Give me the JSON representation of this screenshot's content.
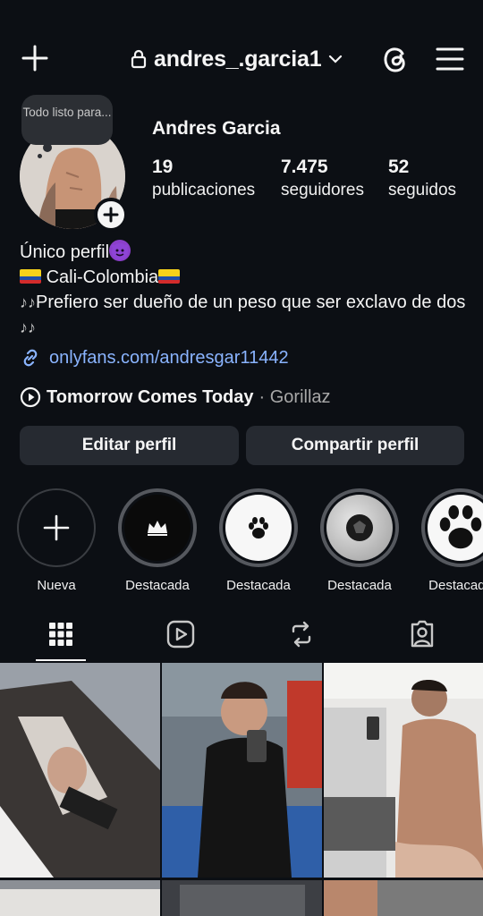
{
  "header": {
    "username": "andres_.garcia1",
    "icons": [
      "plus-icon",
      "lock-icon",
      "chevron-down-icon",
      "threads-icon",
      "menu-icon"
    ]
  },
  "profile": {
    "note": "Todo listo para...",
    "full_name": "Andres Garcia",
    "stats": [
      {
        "value": "19",
        "label": "publicaciones"
      },
      {
        "value": "7.475",
        "label": "seguidores"
      },
      {
        "value": "52",
        "label": "seguidos"
      }
    ]
  },
  "bio": {
    "line1": "Único perfil",
    "line2": "Cali-Colombia",
    "line3": "Prefiero ser dueño de un peso que ser exclavo de dos",
    "link": "onlyfans.com/andresgar11442",
    "song": "Tomorrow Comes Today",
    "artist": "· Gorillaz"
  },
  "buttons": {
    "edit": "Editar perfil",
    "share": "Compartir perfil"
  },
  "highlights": [
    {
      "label": "Nueva",
      "icon": "plus-icon"
    },
    {
      "label": "Destacada",
      "icon": "crown-icon"
    },
    {
      "label": "Destacada",
      "icon": "paw-icon"
    },
    {
      "label": "Destacada",
      "icon": "ball-icon"
    },
    {
      "label": "Destacada",
      "icon": "paw-icon"
    }
  ],
  "tabs": [
    {
      "name": "grid-icon",
      "active": true
    },
    {
      "name": "reels-icon",
      "active": false
    },
    {
      "name": "reposts-icon",
      "active": false
    },
    {
      "name": "tagged-icon",
      "active": false
    }
  ],
  "colors": {
    "background": "#0c0f14",
    "button": "#262a31",
    "link": "#8ab4ff"
  }
}
